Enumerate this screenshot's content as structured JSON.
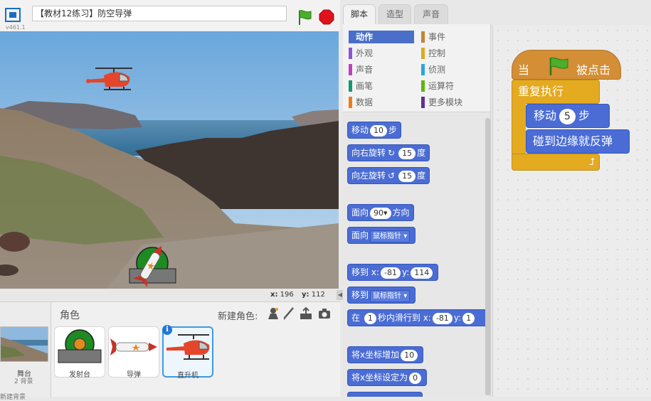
{
  "header": {
    "version": "v461.1",
    "project_title": "【教材12练习】防空导弹"
  },
  "stage": {
    "mouse_x_label": "x:",
    "mouse_x": "196",
    "mouse_y_label": "y:",
    "mouse_y": "112"
  },
  "sprite_pane": {
    "sprites_label": "角色",
    "new_sprite_label": "新建角色:",
    "stage_label": "舞台",
    "stage_backdrops": "2 背景",
    "new_backdrop_label": "新建背景",
    "sprites": [
      {
        "name": "发射台"
      },
      {
        "name": "导弹"
      },
      {
        "name": "直升机",
        "selected": true
      }
    ]
  },
  "tabs": [
    {
      "label": "脚本",
      "active": true
    },
    {
      "label": "造型",
      "active": false
    },
    {
      "label": "声音",
      "active": false
    }
  ],
  "categories": {
    "left": [
      {
        "label": "动作",
        "color": "#4a6cd4",
        "active": true
      },
      {
        "label": "外观",
        "color": "#8a55d7"
      },
      {
        "label": "声音",
        "color": "#bb42c3"
      },
      {
        "label": "画笔",
        "color": "#0e9a6c"
      },
      {
        "label": "数据",
        "color": "#ee7d16"
      }
    ],
    "right": [
      {
        "label": "事件",
        "color": "#c88330"
      },
      {
        "label": "控制",
        "color": "#e1a91a"
      },
      {
        "label": "侦测",
        "color": "#2ca5e2"
      },
      {
        "label": "运算符",
        "color": "#5cb712"
      },
      {
        "label": "更多模块",
        "color": "#632d99"
      }
    ]
  },
  "palette_blocks": {
    "move": {
      "label": "移动",
      "value": "10",
      "suffix": "步"
    },
    "turn_right": {
      "label": "向右旋转",
      "value": "15",
      "suffix": "度"
    },
    "turn_left": {
      "label": "向左旋转",
      "value": "15",
      "suffix": "度"
    },
    "point_dir": {
      "label": "面向",
      "value": "90▾",
      "suffix": "方向"
    },
    "point_towards": {
      "label": "面向",
      "dropdown": "鼠标指针 ▾"
    },
    "goto_xy": {
      "label": "移到",
      "x_label": "x:",
      "x": "-81",
      "y_label": "y:",
      "y": "114"
    },
    "goto": {
      "label": "移到",
      "dropdown": "鼠标指针 ▾"
    },
    "glide": {
      "label": "在",
      "secs": "1",
      "mid": "秒内滑行到",
      "x_label": "x:",
      "x": "-81",
      "y_label": "y:",
      "y": "1"
    },
    "change_x": {
      "label": "将x坐标增加",
      "value": "10"
    },
    "set_x": {
      "label": "将x坐标设定为",
      "value": "0"
    }
  },
  "script": {
    "hat_prefix": "当",
    "hat_suffix": "被点击",
    "forever": "重复执行",
    "move_label": "移动",
    "move_value": "5",
    "move_suffix": "步",
    "bounce": "碰到边缘就反弹",
    "loop_arrow": "⮥"
  }
}
